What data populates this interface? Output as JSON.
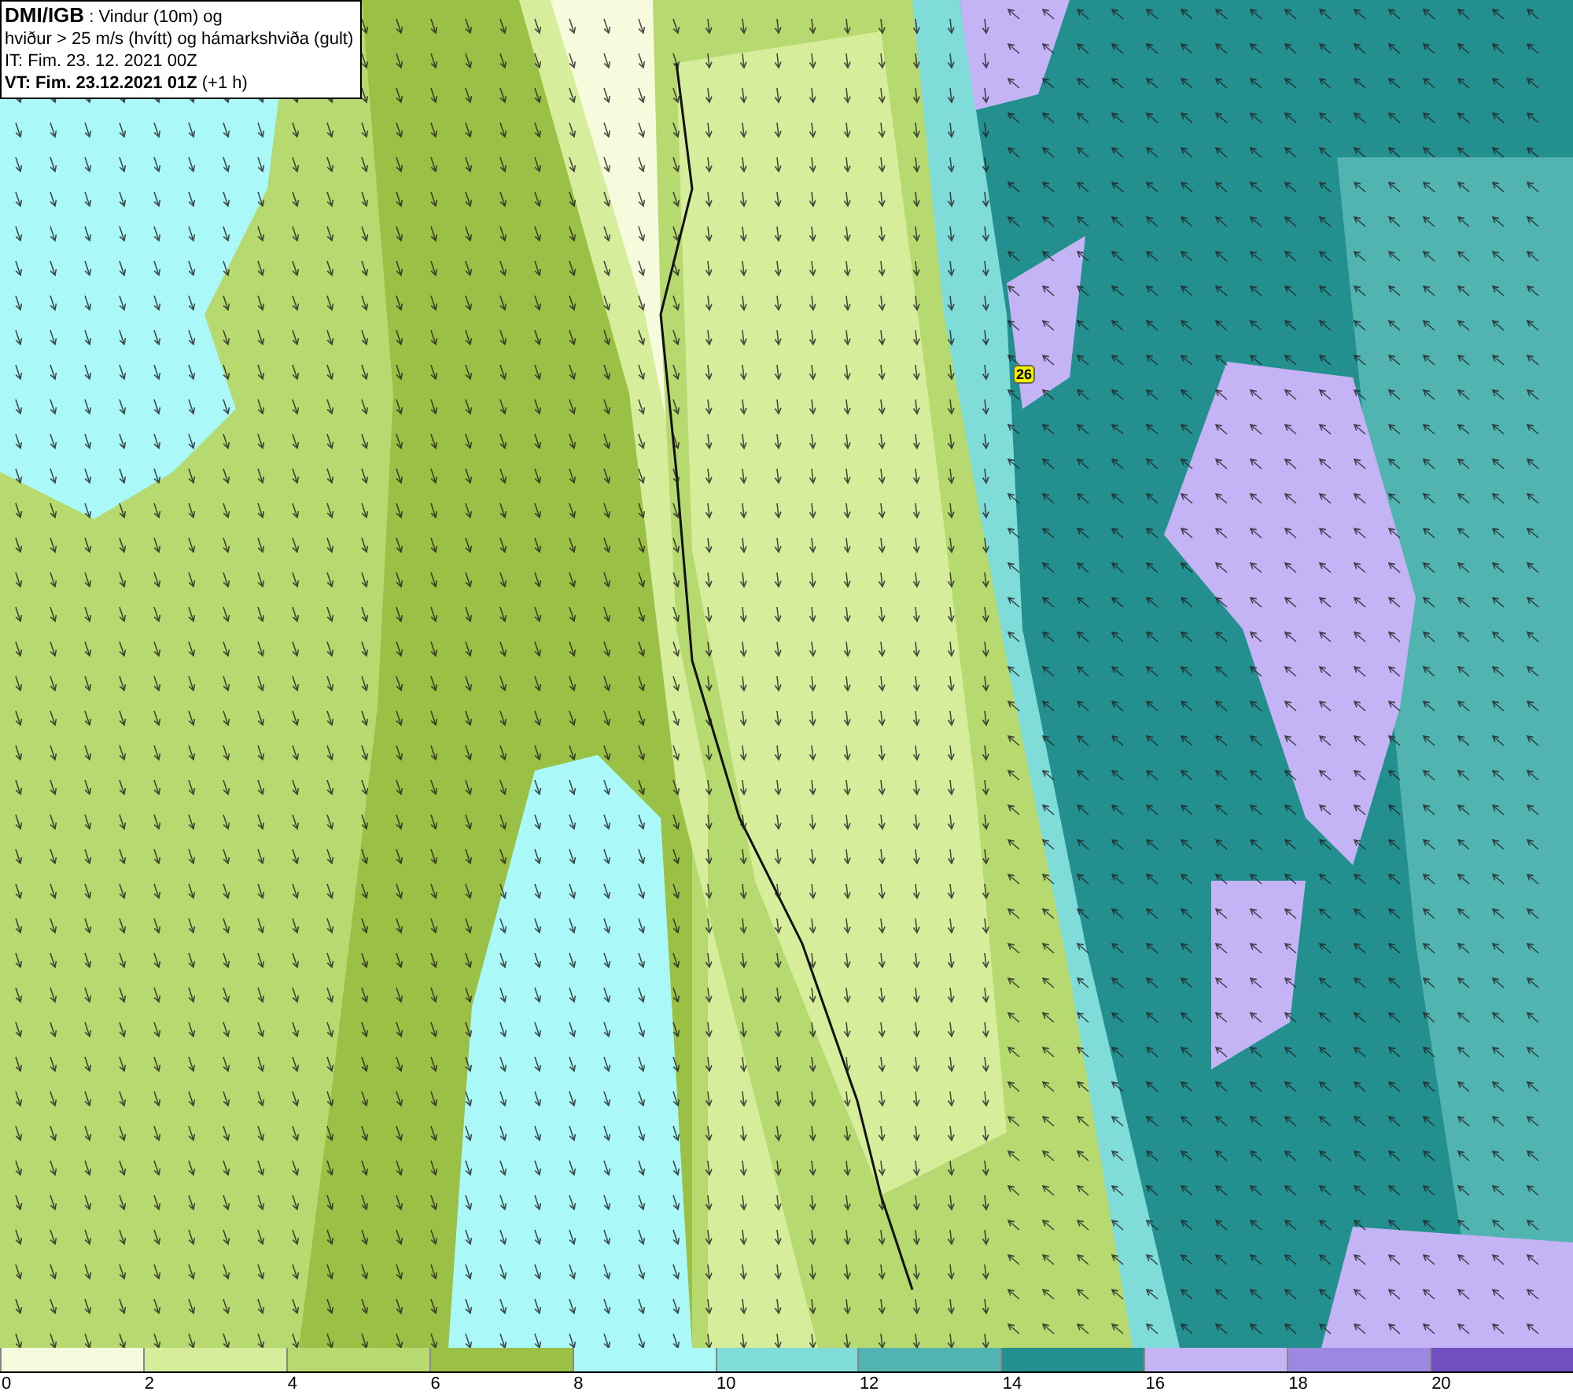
{
  "title_box": {
    "lines": [
      "**DMI/IGB** : Vindur (10m) og",
      "hviður > 25 m/s (hvítt) og hámarkshviða (gult)",
      "IT: Fim. 23. 12. 2021 00Z",
      "**VT: Fim. 23.12.2021 01Z** (+1 h)"
    ]
  },
  "map": {
    "gust_markers": [
      "26"
    ]
  },
  "legend": {
    "segments": [
      {
        "label": "0",
        "color": "#f5fbdc"
      },
      {
        "label": "2",
        "color": "#d6ee9c"
      },
      {
        "label": "4",
        "color": "#b6d970"
      },
      {
        "label": "6",
        "color": "#9bc046"
      },
      {
        "label": "8",
        "color": "#aaf8f8"
      },
      {
        "label": "10",
        "color": "#80dcd8"
      },
      {
        "label": "12",
        "color": "#52b4b0"
      },
      {
        "label": "14",
        "color": "#248f8f"
      },
      {
        "label": "16",
        "color": "#c4b4f6"
      },
      {
        "label": "18",
        "color": "#9c88e0"
      },
      {
        "label": "20",
        "color": "#7050c0"
      }
    ]
  }
}
